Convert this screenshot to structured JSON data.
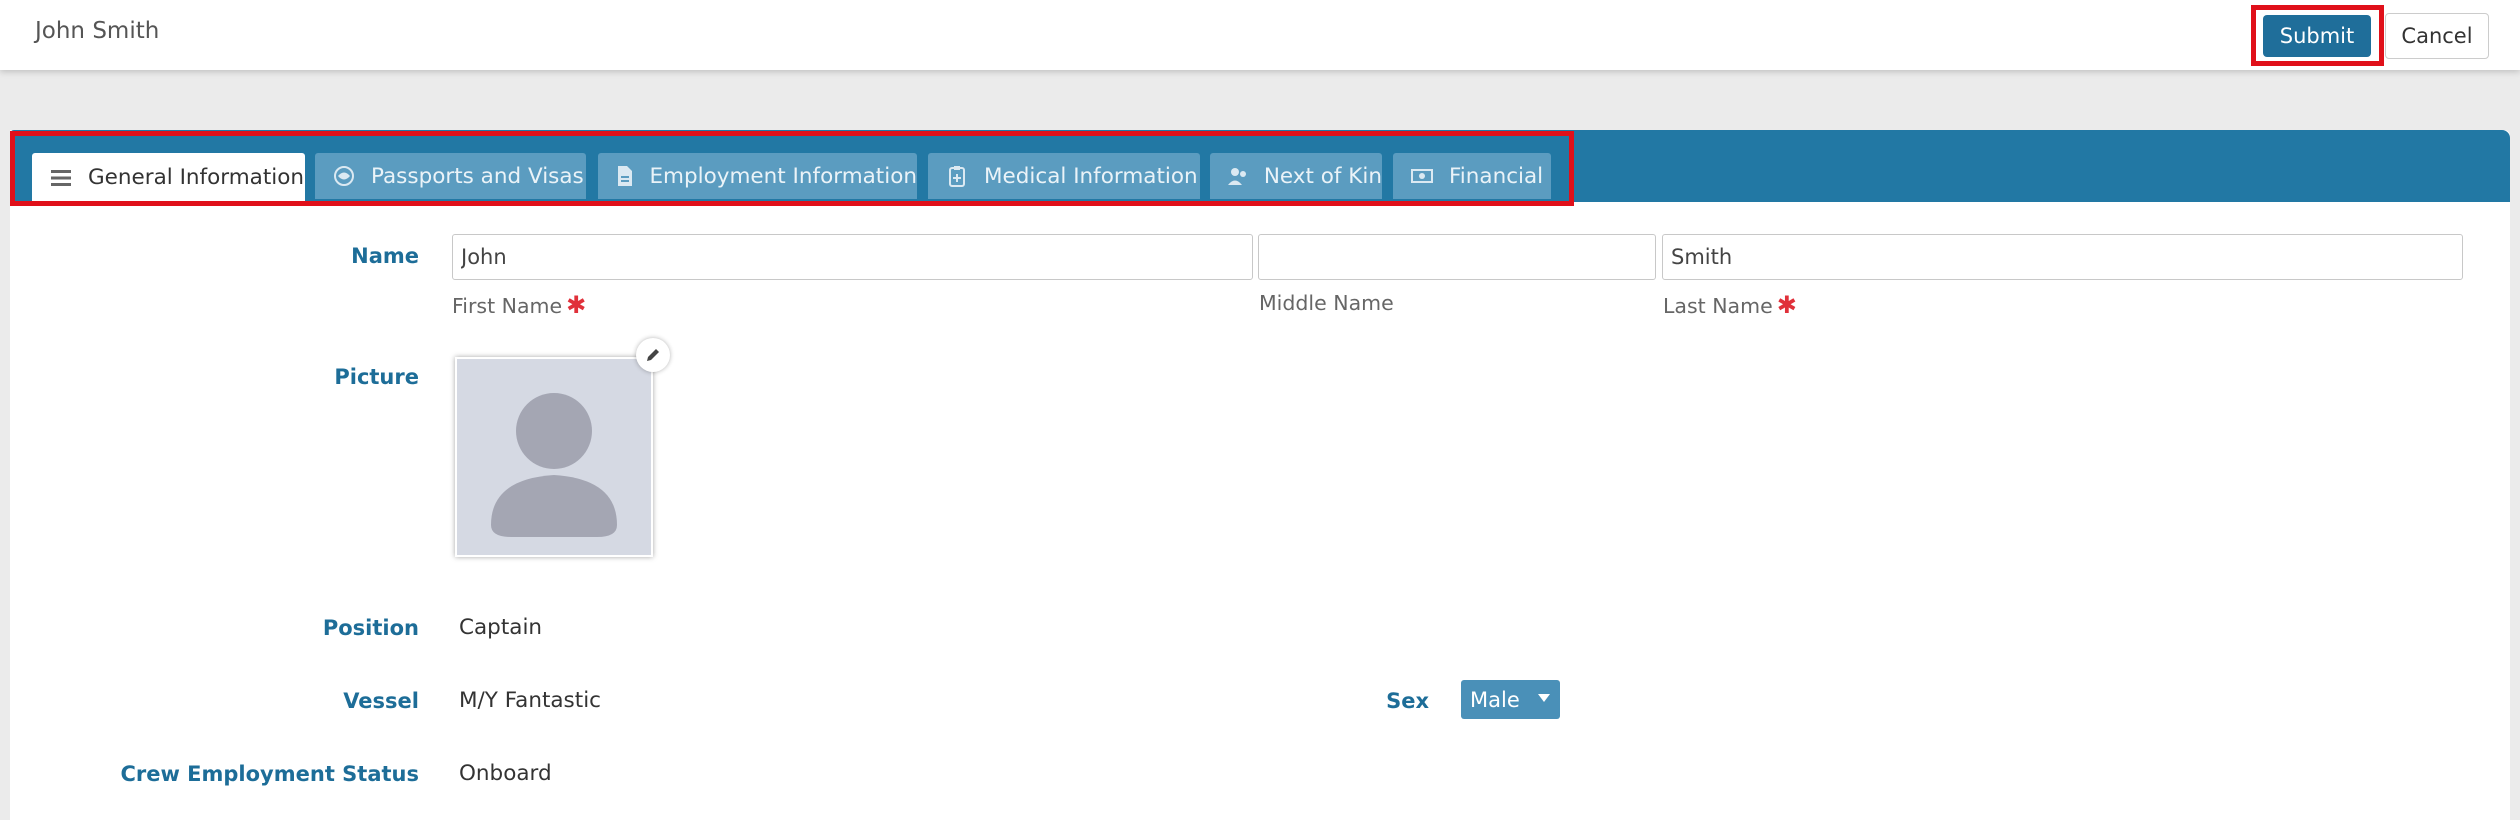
{
  "header": {
    "title": "John Smith",
    "submit_label": "Submit",
    "cancel_label": "Cancel"
  },
  "tabs": [
    {
      "label": "General Information",
      "icon": "list-icon",
      "active": true
    },
    {
      "label": "Passports and Visas",
      "icon": "passport-icon",
      "active": false
    },
    {
      "label": "Employment Information",
      "icon": "document-icon",
      "active": false
    },
    {
      "label": "Medical Information",
      "icon": "medical-clipboard-icon",
      "active": false
    },
    {
      "label": "Next of Kin",
      "icon": "people-icon",
      "active": false
    },
    {
      "label": "Financial",
      "icon": "money-icon",
      "active": false
    }
  ],
  "form": {
    "name_label": "Name",
    "first_name": {
      "value": "John",
      "sublabel": "First Name",
      "required": "✱"
    },
    "middle_name": {
      "value": "",
      "sublabel": "Middle Name"
    },
    "last_name": {
      "value": "Smith",
      "sublabel": "Last Name",
      "required": "✱"
    },
    "picture_label": "Picture",
    "position_label": "Position",
    "position_value": "Captain",
    "vessel_label": "Vessel",
    "vessel_value": "M/Y Fantastic",
    "sex_label": "Sex",
    "sex_value": "Male",
    "status_label": "Crew Employment Status",
    "status_value": "Onboard"
  },
  "colors": {
    "accent": "#2278a4",
    "label": "#1d6d98",
    "highlight": "#e0101a",
    "required": "#e0303a"
  }
}
